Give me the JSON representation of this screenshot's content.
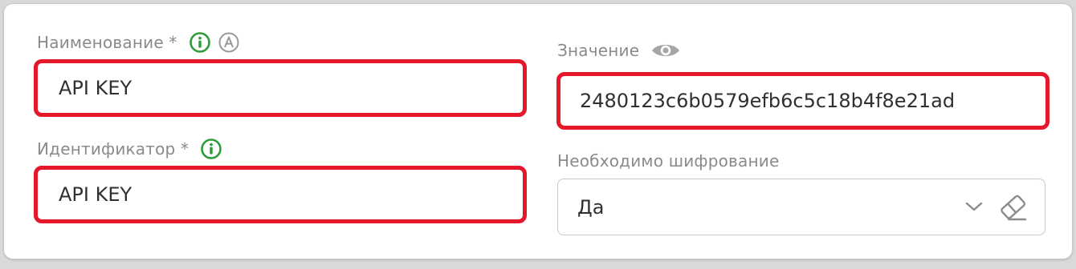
{
  "fields": {
    "name": {
      "label": "Наименование *",
      "value": "API KEY",
      "icons": [
        "info-icon",
        "auto-icon"
      ],
      "highlighted": true
    },
    "identifier": {
      "label": "Идентификатор *",
      "value": "API KEY",
      "icons": [
        "info-icon"
      ],
      "highlighted": true
    },
    "value": {
      "label": "Значение",
      "value": "2480123c6b0579efb6c5c18b4f8e21ad",
      "icons": [
        "eye-icon"
      ],
      "highlighted": true
    },
    "encryption": {
      "label": "Необходимо шифрование",
      "value": "Да",
      "icons": [
        "chevron-down-icon",
        "eraser-icon"
      ],
      "highlighted": false
    }
  },
  "colors": {
    "highlight_border": "#e5182a",
    "info_icon": "#2e9b3a",
    "muted_icon": "#9a9a9a",
    "label_text": "#8a8a8a",
    "value_text": "#303030"
  }
}
